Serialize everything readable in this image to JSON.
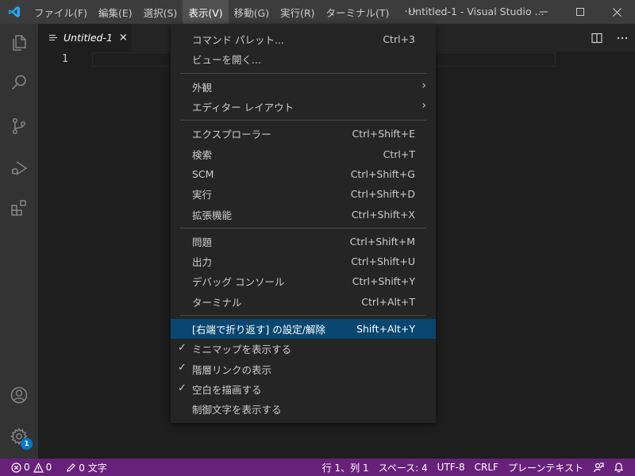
{
  "menubar": {
    "items": [
      "ファイル(F)",
      "編集(E)",
      "選択(S)",
      "表示(V)",
      "移動(G)",
      "実行(R)",
      "ターミナル(T)"
    ],
    "more": "···"
  },
  "window": {
    "title": "Untitled-1 - Visual Studio ..."
  },
  "tab": {
    "label": "Untitled-1",
    "close": "×"
  },
  "editor": {
    "line_number": "1"
  },
  "dropdown": {
    "groups": [
      [
        {
          "label": "コマンド パレット...",
          "shortcut": "Ctrl+3"
        },
        {
          "label": "ビューを開く...",
          "shortcut": ""
        }
      ],
      [
        {
          "label": "外観",
          "shortcut": "",
          "arrow": "›"
        },
        {
          "label": "エディター レイアウト",
          "shortcut": "",
          "arrow": "›"
        }
      ],
      [
        {
          "label": "エクスプローラー",
          "shortcut": "Ctrl+Shift+E"
        },
        {
          "label": "検索",
          "shortcut": "Ctrl+T"
        },
        {
          "label": "SCM",
          "shortcut": "Ctrl+Shift+G"
        },
        {
          "label": "実行",
          "shortcut": "Ctrl+Shift+D"
        },
        {
          "label": "拡張機能",
          "shortcut": "Ctrl+Shift+X"
        }
      ],
      [
        {
          "label": "問題",
          "shortcut": "Ctrl+Shift+M"
        },
        {
          "label": "出力",
          "shortcut": "Ctrl+Shift+U"
        },
        {
          "label": "デバッグ コンソール",
          "shortcut": "Ctrl+Shift+Y"
        },
        {
          "label": "ターミナル",
          "shortcut": "Ctrl+Alt+T"
        }
      ],
      [
        {
          "label": "[右端で折り返す] の設定/解除",
          "shortcut": "Shift+Alt+Y",
          "highlight": true
        },
        {
          "label": "ミニマップを表示する",
          "shortcut": "",
          "check": "✓"
        },
        {
          "label": "階層リンクの表示",
          "shortcut": "",
          "check": "✓"
        },
        {
          "label": "空白を描画する",
          "shortcut": "",
          "check": "✓"
        },
        {
          "label": "制御文字を表示する",
          "shortcut": ""
        }
      ]
    ]
  },
  "activitybar": {
    "badge": "1"
  },
  "statusbar": {
    "errors": "0",
    "warnings": "0",
    "chars": "0 文字",
    "position": "行 1、列 1",
    "spaces": "スペース: 4",
    "encoding": "UTF-8",
    "eol": "CRLF",
    "language": "プレーンテキスト"
  },
  "colors": {
    "statusbar_bg": "#68217a",
    "highlight_bg": "#094771",
    "accent": "#007acc"
  }
}
